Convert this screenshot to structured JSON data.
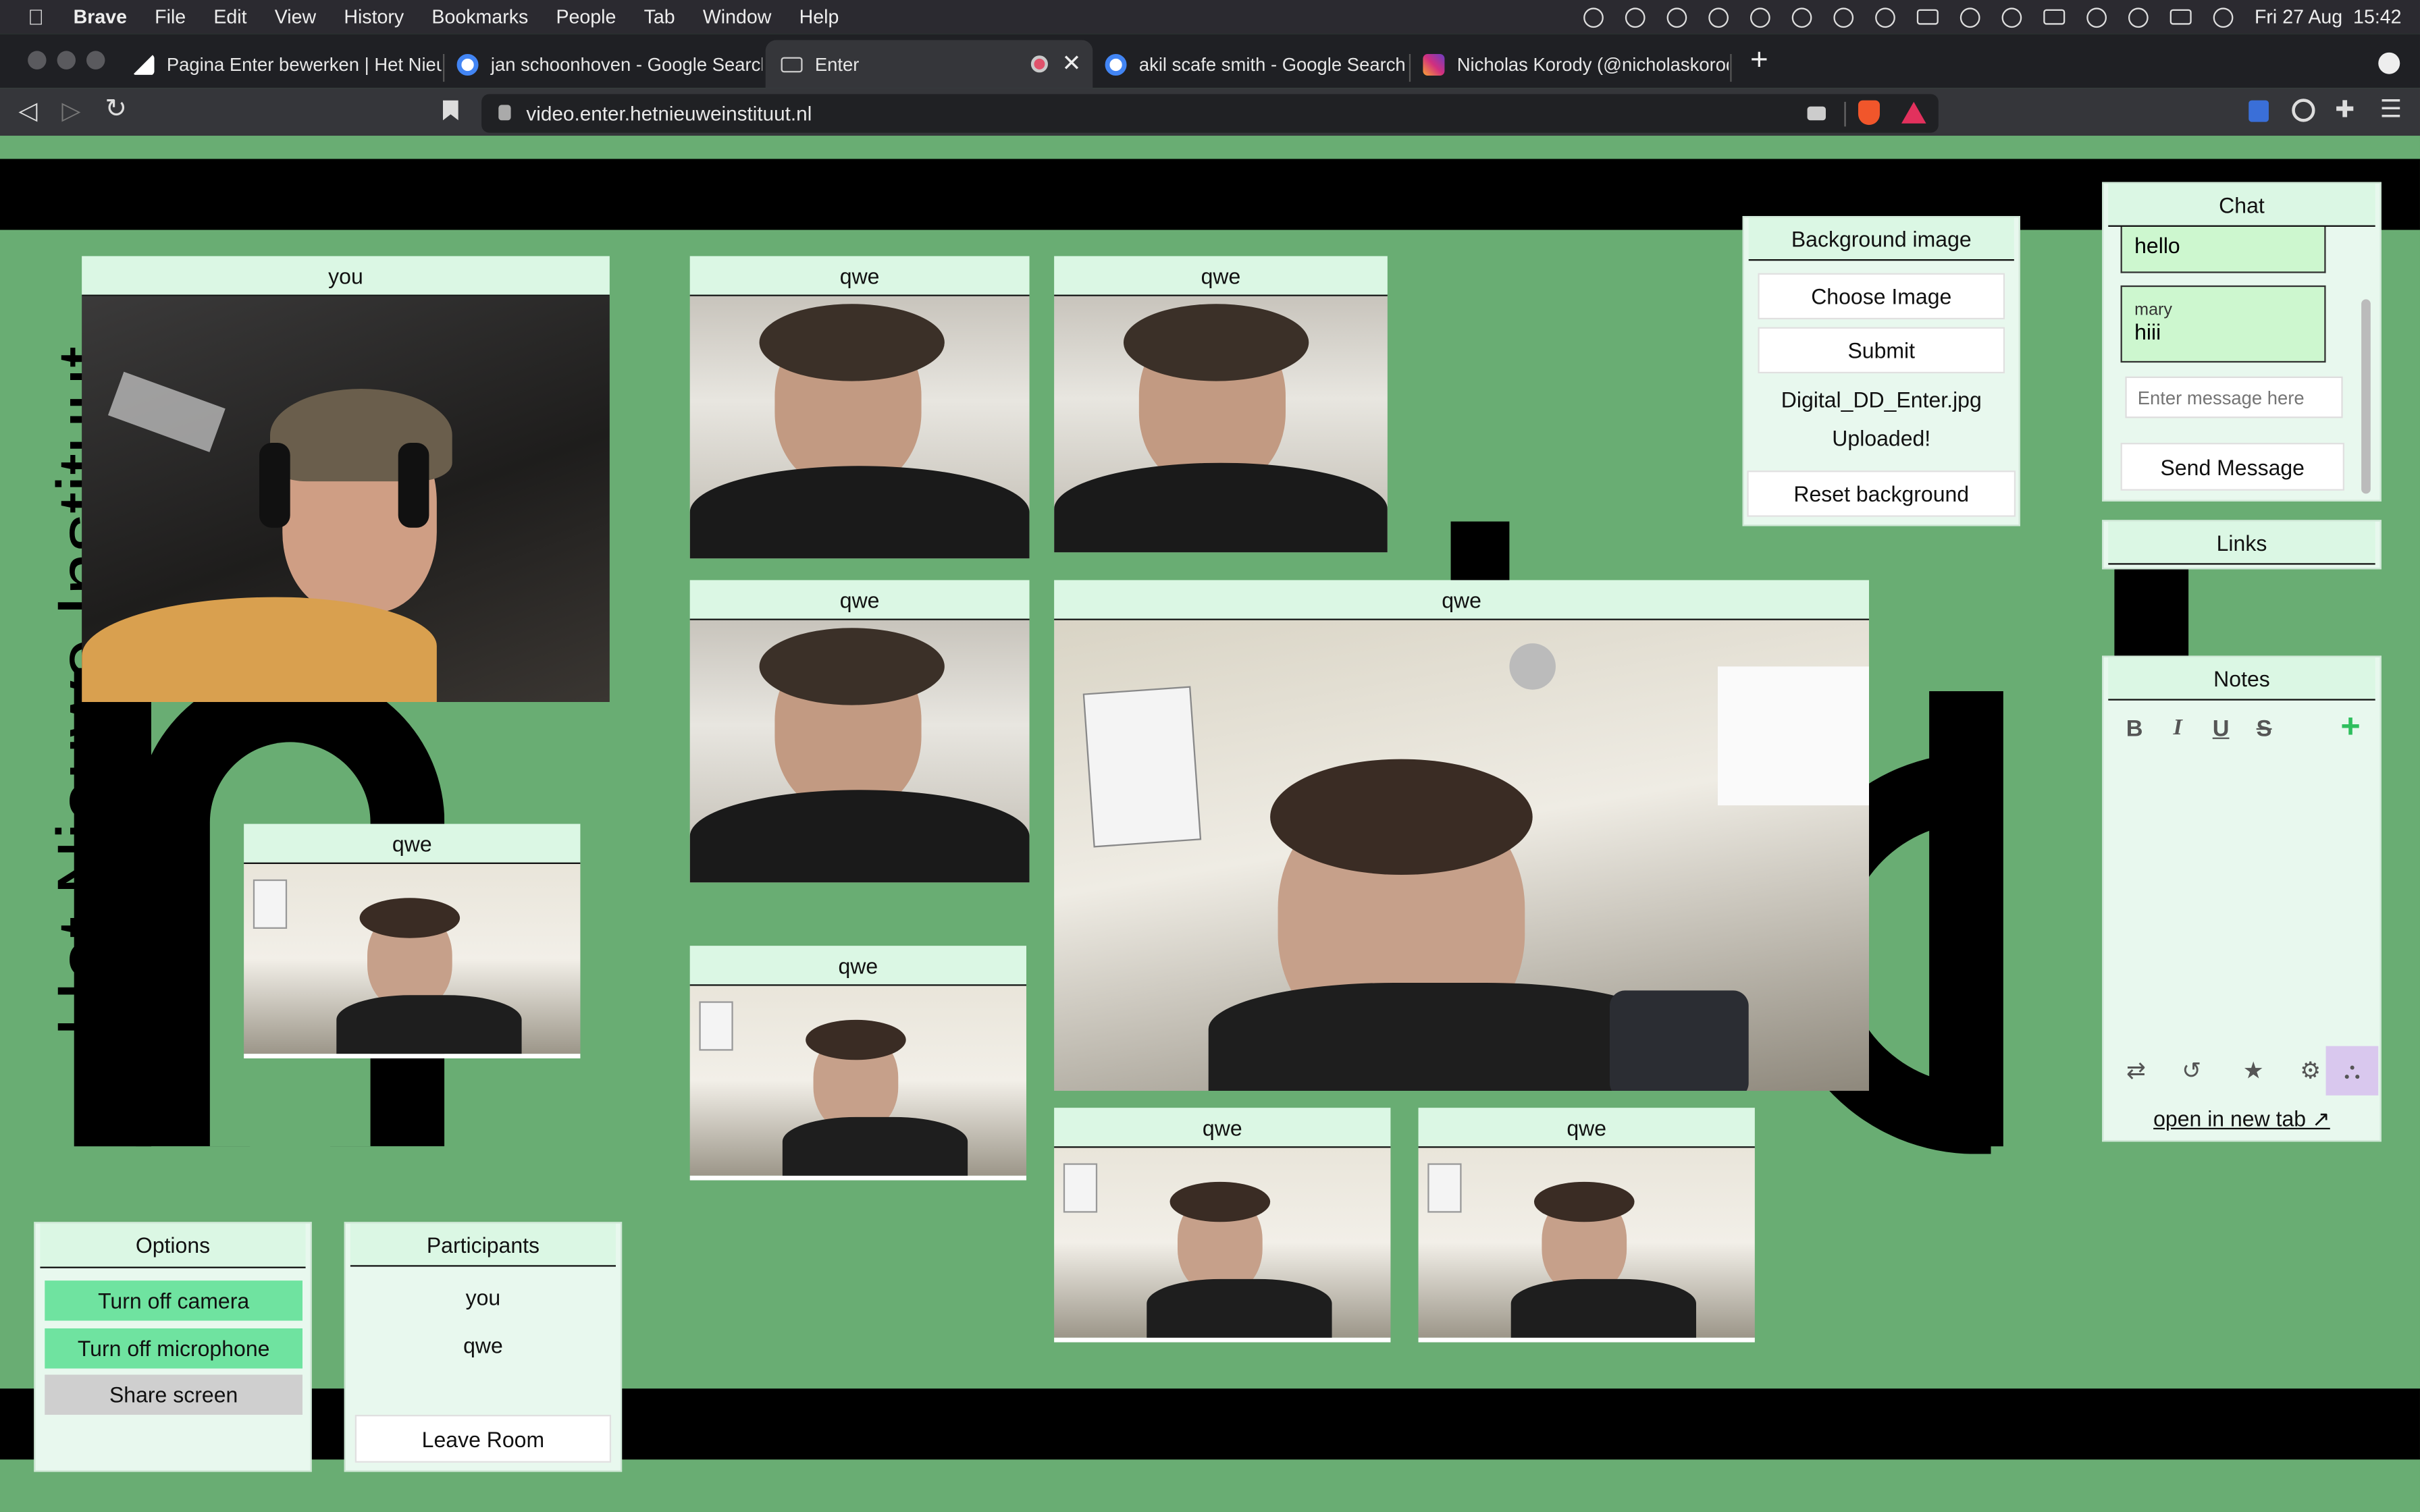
{
  "menubar": {
    "apple": "",
    "app": "Brave",
    "items": [
      "File",
      "Edit",
      "View",
      "History",
      "Bookmarks",
      "People",
      "Tab",
      "Window",
      "Help"
    ],
    "datetime": "Fri 27 Aug  15:42"
  },
  "tabs": [
    {
      "label": "Pagina Enter bewerken | Het Nieuwe",
      "active": false
    },
    {
      "label": "jan schoonhoven - Google Search",
      "active": false
    },
    {
      "label": "Enter",
      "active": true
    },
    {
      "label": "akil scafe smith - Google Search",
      "active": false
    },
    {
      "label": "Nicholas Korody (@nicholaskorody)",
      "active": false
    }
  ],
  "toolbar": {
    "url": "video.enter.hetnieuweinstituut.nl"
  },
  "background_text": "Het Nieuwe Instituut",
  "tiles": {
    "you": {
      "label": "you"
    },
    "t1": {
      "label": "qwe"
    },
    "t2": {
      "label": "qwe"
    },
    "t3": {
      "label": "qwe"
    },
    "t4": {
      "label": "qwe"
    },
    "t5": {
      "label": "qwe"
    },
    "t6": {
      "label": "qwe"
    },
    "t7": {
      "label": "qwe"
    },
    "t8": {
      "label": "qwe"
    }
  },
  "background_panel": {
    "title": "Background image",
    "choose": "Choose Image",
    "submit": "Submit",
    "filename": "Digital_DD_Enter.jpg",
    "status": "Uploaded!",
    "reset": "Reset background"
  },
  "chat": {
    "title": "Chat",
    "messages": [
      {
        "author": "",
        "text": "hello"
      },
      {
        "author": "mary",
        "text": "hiii"
      }
    ],
    "placeholder": "Enter message here",
    "send": "Send Message"
  },
  "links": {
    "title": "Links"
  },
  "notes": {
    "title": "Notes",
    "bold": "B",
    "italic": "I",
    "underline": "U",
    "strike": "S",
    "add": "+",
    "open": "open in new tab ↗"
  },
  "options": {
    "title": "Options",
    "camera": "Turn off camera",
    "microphone": "Turn off microphone",
    "share": "Share screen"
  },
  "participants": {
    "title": "Participants",
    "list": [
      "you",
      "qwe"
    ],
    "leave": "Leave Room"
  },
  "colors": {
    "page_bg": "#69ad73",
    "panel_bg": "#e8f8ee",
    "header_bg": "#dbf7e4",
    "green_button": "#6fe3a0",
    "grey_button": "#cfcfcf"
  }
}
